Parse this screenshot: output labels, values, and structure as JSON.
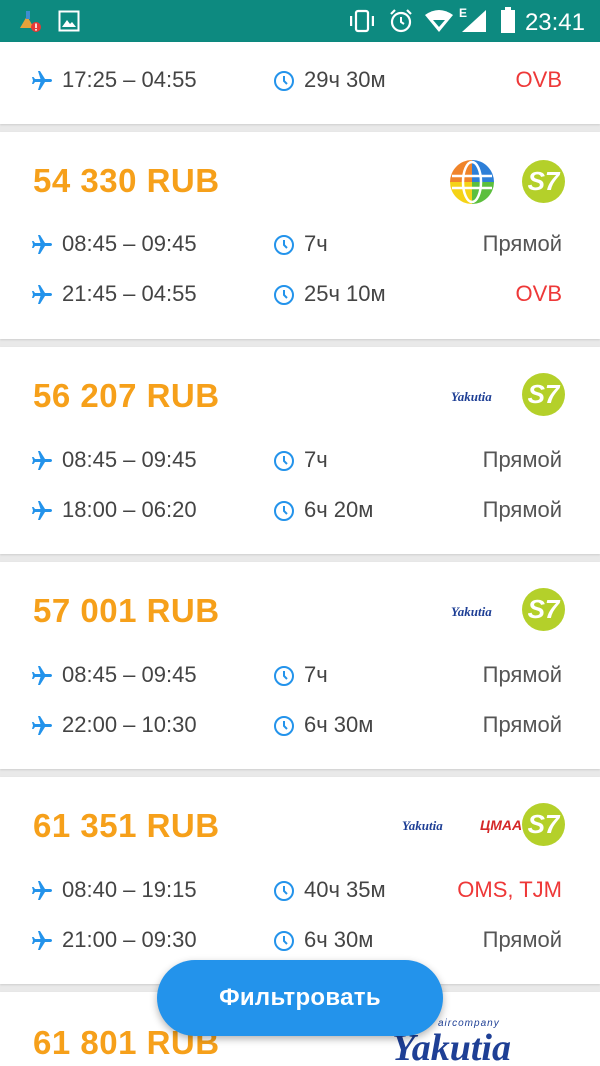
{
  "status_bar": {
    "time": "23:41",
    "network_label": "E",
    "icons": [
      "cleaner-app-icon",
      "gallery-icon",
      "vibrate-icon",
      "alarm-icon",
      "wifi-icon",
      "signal-icon",
      "battery-icon"
    ]
  },
  "colors": {
    "price": "#f6a01a",
    "accent_blue": "#2393eb",
    "stop_red": "#ee3838",
    "s7_green": "#b4d02a",
    "status_bar": "#0d8a80"
  },
  "results": [
    {
      "price": "",
      "airlines": [],
      "segments": [
        {
          "times": "17:25 – 04:55",
          "duration": "29ч 30м",
          "stops": "OVB",
          "stops_highlight": true
        }
      ]
    },
    {
      "price": "54 330 RUB",
      "airlines": [
        "multi-carrier-globe-logo",
        "s7-logo"
      ],
      "segments": [
        {
          "times": "08:45 – 09:45",
          "duration": "7ч",
          "stops": "Прямой",
          "stops_highlight": false
        },
        {
          "times": "21:45 – 04:55",
          "duration": "25ч 10м",
          "stops": "OVB",
          "stops_highlight": true
        }
      ]
    },
    {
      "price": "56 207 RUB",
      "airlines": [
        "yakutia-logo",
        "s7-logo"
      ],
      "segments": [
        {
          "times": "08:45 – 09:45",
          "duration": "7ч",
          "stops": "Прямой",
          "stops_highlight": false
        },
        {
          "times": "18:00 – 06:20",
          "duration": "6ч 20м",
          "stops": "Прямой",
          "stops_highlight": false
        }
      ]
    },
    {
      "price": "57 001 RUB",
      "airlines": [
        "yakutia-logo",
        "s7-logo"
      ],
      "segments": [
        {
          "times": "08:45 – 09:45",
          "duration": "7ч",
          "stops": "Прямой",
          "stops_highlight": false
        },
        {
          "times": "22:00 – 10:30",
          "duration": "6ч 30м",
          "stops": "Прямой",
          "stops_highlight": false
        }
      ]
    },
    {
      "price": "61 351 RUB",
      "airlines": [
        "yakutia-logo",
        "red-airline-logo",
        "s7-logo"
      ],
      "segments": [
        {
          "times": "08:40 – 19:15",
          "duration": "40ч 35м",
          "stops": "OMS, TJM",
          "stops_highlight": true
        },
        {
          "times": "21:00 – 09:30",
          "duration": "6ч 30м",
          "stops": "Прямой",
          "stops_highlight": false
        }
      ]
    },
    {
      "price": "61 801 RUB",
      "airlines": [
        "yakutia-aircompany-logo"
      ],
      "segments": []
    }
  ],
  "logos": {
    "yakutia_text": "Yakutia",
    "yakutia_tagline": "aircompany",
    "red_airline_text": "ЦМАА",
    "s7_text": "S7"
  },
  "filter_button": {
    "label": "Фильтровать"
  }
}
